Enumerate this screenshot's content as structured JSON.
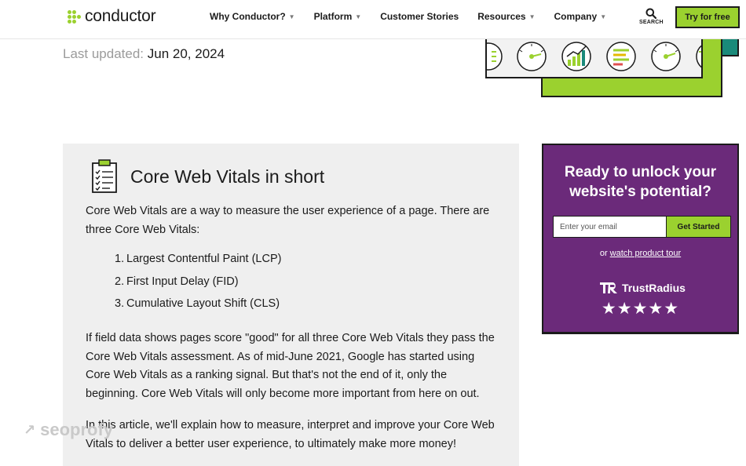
{
  "header": {
    "brand": "conductor",
    "nav": [
      {
        "label": "Why Conductor?",
        "has_dropdown": true
      },
      {
        "label": "Platform",
        "has_dropdown": true
      },
      {
        "label": "Customer Stories",
        "has_dropdown": false
      },
      {
        "label": "Resources",
        "has_dropdown": true
      },
      {
        "label": "Company",
        "has_dropdown": true
      }
    ],
    "search_label": "SEARCH",
    "cta_label": "Try for free"
  },
  "article": {
    "last_updated_label": "Last updated:",
    "last_updated_value": "Jun 20, 2024"
  },
  "summary": {
    "title": "Core Web Vitals in short",
    "intro": "Core Web Vitals are a way to measure the user experience of a page. There are three Core Web Vitals:",
    "items": [
      {
        "num": "1.",
        "text": "Largest Contentful Paint (LCP)"
      },
      {
        "num": "2.",
        "text": "First Input Delay (FID)"
      },
      {
        "num": "3.",
        "text": "Cumulative Layout Shift (CLS)"
      }
    ],
    "para2": "If field data shows pages score \"good\" for all three Core Web Vitals they pass the Core Web Vitals assessment. As of mid-June 2021, Google has started using Core Web Vitals as a ranking signal. But that's not the end of it, only the beginning. Core Web Vitals will only become more important from here on out.",
    "para3": "In this article, we'll explain how to measure, interpret and improve your Core Web Vitals to deliver a better user experience, to ultimately make more money!"
  },
  "sidebar_cta": {
    "title": "Ready to unlock your website's potential?",
    "email_placeholder": "Enter your email",
    "button_label": "Get Started",
    "tour_prefix": "or",
    "tour_link": "watch product tour",
    "review_brand": "TrustRadius",
    "stars": "★★★★★",
    "rating": 5
  },
  "watermark": "seoprofy",
  "colors": {
    "accent_green": "#9bd12f",
    "purple": "#6b2a7a",
    "teal": "#1a8a7a",
    "text": "#1b1b1b",
    "muted": "#9b9b9b",
    "panel": "#efefef"
  },
  "icons": {
    "logo": "conductor-dots-logo",
    "search": "search-icon",
    "checklist": "clipboard-checklist-icon",
    "trustradius": "trustradius-logo"
  }
}
